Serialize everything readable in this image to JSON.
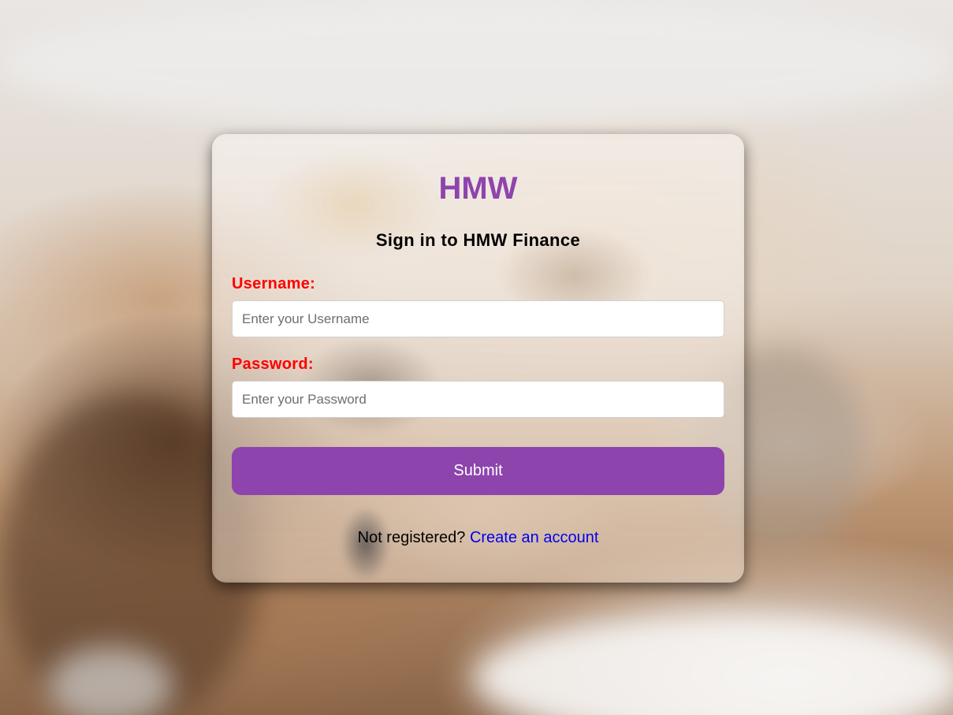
{
  "login": {
    "brand": "HMW",
    "heading": "Sign in to HMW Finance",
    "username_label": "Username:",
    "username_placeholder": "Enter your Username",
    "password_label": "Password:",
    "password_placeholder": "Enter your Password",
    "submit_label": "Submit",
    "register_prompt": "Not registered?",
    "register_link": "Create an account"
  },
  "colors": {
    "brand": "#8e44ad",
    "label": "#ff0000",
    "link": "#0000ee"
  },
  "background": {
    "description": "blurred-kitten-photo"
  }
}
